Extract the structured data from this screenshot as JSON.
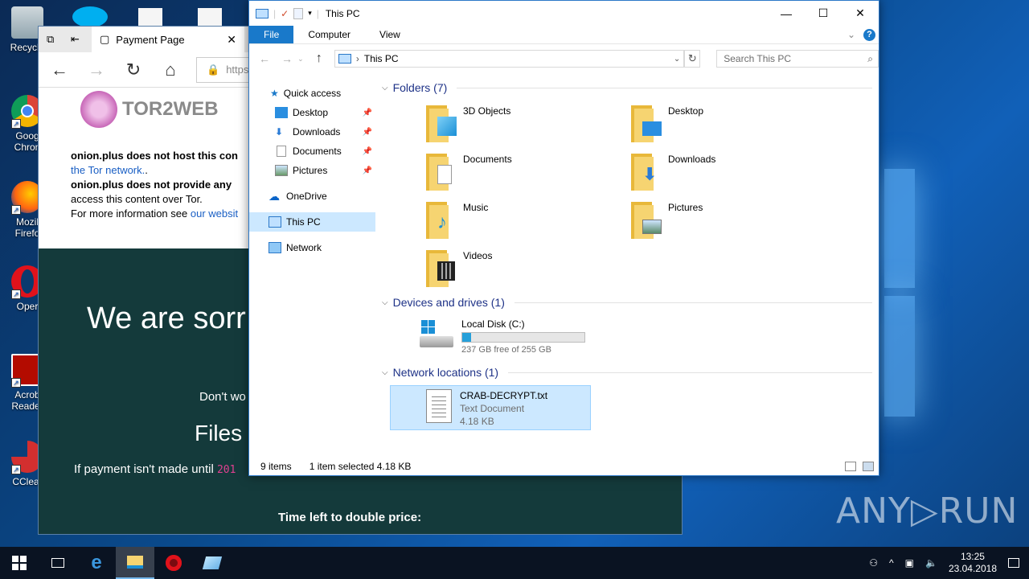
{
  "desktop": {
    "icons": [
      {
        "label": "Recycle",
        "name": "recycle-bin-icon"
      },
      {
        "label": "Goog\nChron",
        "name": "chrome-icon"
      },
      {
        "label": "Mozil\nFirefo",
        "name": "firefox-icon"
      },
      {
        "label": "Oper",
        "name": "opera-icon"
      },
      {
        "label": "Acrob\nReader",
        "name": "acrobat-icon"
      },
      {
        "label": "CClear",
        "name": "ccleaner-icon"
      }
    ],
    "watermark": "ANY▷RUN"
  },
  "browser": {
    "tab_title": "Payment Page",
    "url_partial": "https",
    "tor_logo_text": "TOR2WEB",
    "notice_line1": "onion.plus does not host this con",
    "notice_link1": "the Tor network.",
    "notice_line1_end": ".",
    "notice_line2": "onion.plus does not provide any",
    "notice_line3": "access this content over Tor.",
    "notice_line4": "For more information see",
    "notice_link2": "our websit",
    "ransom_heading": "We are sorr",
    "ransom_text1": "Don't wo",
    "ransom_heading2": "Files c",
    "ransom_text2": "If payment isn't made until",
    "ransom_date_fragment": "201",
    "ransom_timer_label": "Time left to double price:"
  },
  "explorer": {
    "title": "This PC",
    "ribbon_tabs": [
      "File",
      "Computer",
      "View"
    ],
    "address": "This PC",
    "search_placeholder": "Search This PC",
    "nav": {
      "quick_access": "Quick access",
      "desktop": "Desktop",
      "downloads": "Downloads",
      "documents": "Documents",
      "pictures": "Pictures",
      "onedrive": "OneDrive",
      "this_pc": "This PC",
      "network": "Network"
    },
    "groups": {
      "folders": "Folders (7)",
      "devices": "Devices and drives (1)",
      "network": "Network locations (1)"
    },
    "folders": [
      "3D Objects",
      "Desktop",
      "Documents",
      "Downloads",
      "Music",
      "Pictures",
      "Videos"
    ],
    "drive": {
      "name": "Local Disk (C:)",
      "free_text": "237 GB free of 255 GB",
      "used_fraction": 0.07
    },
    "net_item": {
      "name": "CRAB-DECRYPT.txt",
      "type": "Text Document",
      "size": "4.18 KB"
    },
    "status": {
      "items": "9 items",
      "selected": "1 item selected  4.18 KB"
    }
  },
  "taskbar": {
    "time": "13:25",
    "date": "23.04.2018"
  }
}
